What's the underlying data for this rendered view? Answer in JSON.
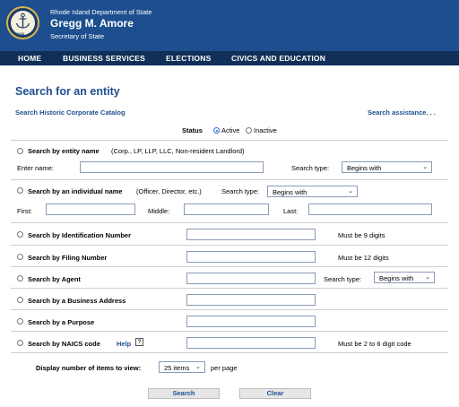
{
  "header": {
    "department": "Rhode Island Department of State",
    "official_name": "Gregg M. Amore",
    "official_title": "Secretary of State",
    "seal_year": "1636",
    "brand_color": "#1d4f8f"
  },
  "nav": {
    "items": [
      "HOME",
      "BUSINESS SERVICES",
      "ELECTIONS",
      "CIVICS AND EDUCATION"
    ]
  },
  "page": {
    "title": "Search for an entity",
    "historic_link": "Search Historic Corporate Catalog",
    "assistance_link": "Search assistance. . ."
  },
  "status": {
    "label": "Status",
    "options": [
      "Active",
      "Inactive"
    ],
    "selected": "Active"
  },
  "entity_name": {
    "radio_label": "Search by entity name",
    "hint": "(Corp., LP, LLP, LLC, Non-resident Landlord)",
    "enter_label": "Enter name:",
    "search_type_label": "Search type:",
    "search_type_value": "Begins with"
  },
  "individual": {
    "radio_label": "Search by an individual name",
    "hint": "(Officer, Director, etc.)",
    "search_type_label": "Search type:",
    "search_type_value": "Begins with",
    "first_label": "First:",
    "middle_label": "Middle:",
    "last_label": "Last:"
  },
  "id_number": {
    "radio_label": "Search by Identification Number",
    "note": "Must be 9 digits"
  },
  "filing_number": {
    "radio_label": "Search by Filing Number",
    "note": "Must be 12 digits"
  },
  "agent": {
    "radio_label": "Search by Agent",
    "search_type_label": "Search type:",
    "search_type_value": "Begins with"
  },
  "business_address": {
    "radio_label": "Search by a Business Address"
  },
  "purpose": {
    "radio_label": "Search by a Purpose"
  },
  "naics": {
    "radio_label": "Search by NAICS code",
    "help_label": "Help",
    "help_icon": "?",
    "note": "Must be 2 to 6 digit code"
  },
  "display": {
    "label": "Display number of items to view:",
    "value": "25 items",
    "suffix": "per page"
  },
  "actions": {
    "search_label": "Search",
    "clear_label": "Clear"
  }
}
